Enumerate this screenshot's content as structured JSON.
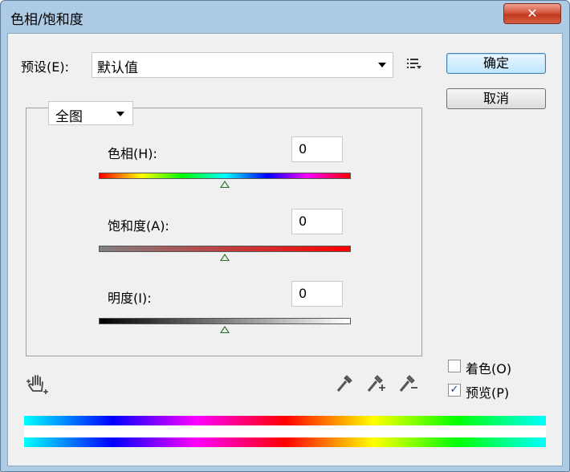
{
  "window": {
    "title": "色相/饱和度",
    "close_symbol": "✕"
  },
  "preset": {
    "label": "预设(E):",
    "value": "默认值"
  },
  "buttons": {
    "ok": "确定",
    "cancel": "取消"
  },
  "channel": {
    "value": "全图"
  },
  "sliders": {
    "hue": {
      "label": "色相(H):",
      "value": "0"
    },
    "saturation": {
      "label": "饱和度(A):",
      "value": "0"
    },
    "lightness": {
      "label": "明度(I):",
      "value": "0"
    }
  },
  "options": {
    "colorize": {
      "label": "着色(O)",
      "checked": false
    },
    "preview": {
      "label": "预览(P)",
      "checked": true,
      "mark": "✓"
    }
  },
  "icons": {
    "menu": "preset-options-icon",
    "hand": "targeted-adjustment-hand-icon",
    "eyedropper": "eyedropper-icon",
    "eyedropper_add": "eyedropper-add-icon",
    "eyedropper_subtract": "eyedropper-subtract-icon"
  }
}
